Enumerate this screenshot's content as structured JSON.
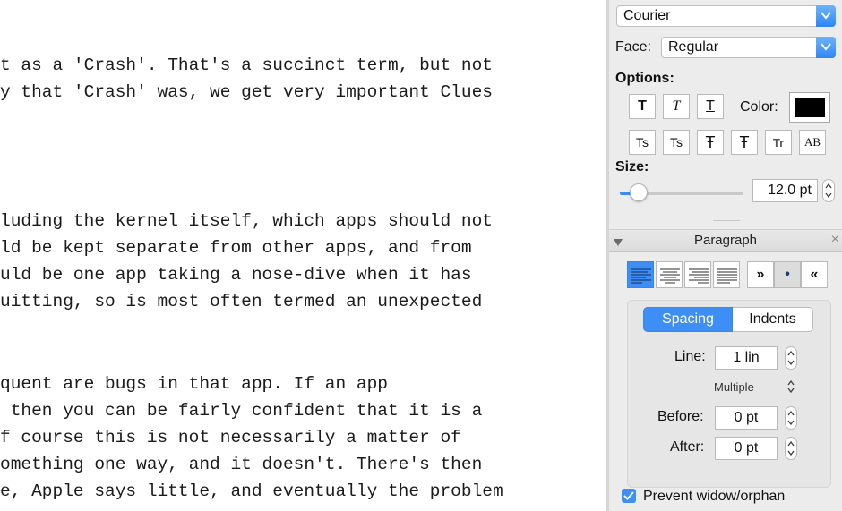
{
  "document": {
    "lines": [
      "t as a 'Crash'. That's a succinct term, but not",
      "y that 'Crash' was, we get very important Clues",
      "luding the kernel itself, which apps should not",
      "ld be kept separate from other apps, and from",
      "uld be one app taking a nose-dive when it has",
      "uitting, so is most often termed an unexpected",
      "quent are bugs in that app. If an app",
      " then you can be fairly confident that it is a",
      "f course this is not necessarily a matter of",
      "omething one way, and it doesn't. There's then",
      "e, Apple says little, and eventually the problem"
    ]
  },
  "font_panel": {
    "family_value": "Courier",
    "face_label": "Face:",
    "face_value": "Regular",
    "options_label": "Options:",
    "style_buttons": [
      "T",
      "T",
      "T"
    ],
    "color_label": "Color:",
    "color_value": "#000000",
    "effect_buttons": [
      "Ts",
      "Ts",
      "Ŧ",
      "Ŧ",
      "Tr",
      "AB"
    ],
    "size_label": "Size:",
    "size_value": "12.0 pt",
    "size_slider_fraction": 0.15
  },
  "paragraph_panel": {
    "title": "Paragraph",
    "close_glyph": "×",
    "direction_buttons": [
      "»",
      "•",
      "«"
    ],
    "tabs": [
      "Spacing",
      "Indents"
    ],
    "line_label": "Line:",
    "line_value": "1 lin",
    "line_mode": "Multiple",
    "before_label": "Before:",
    "before_value": "0 pt",
    "after_label": "After:",
    "after_value": "0 pt",
    "widow_label": "Prevent widow/orphan"
  },
  "colors": {
    "accent": "#3d8ff6",
    "panel_bg": "#ececec"
  }
}
